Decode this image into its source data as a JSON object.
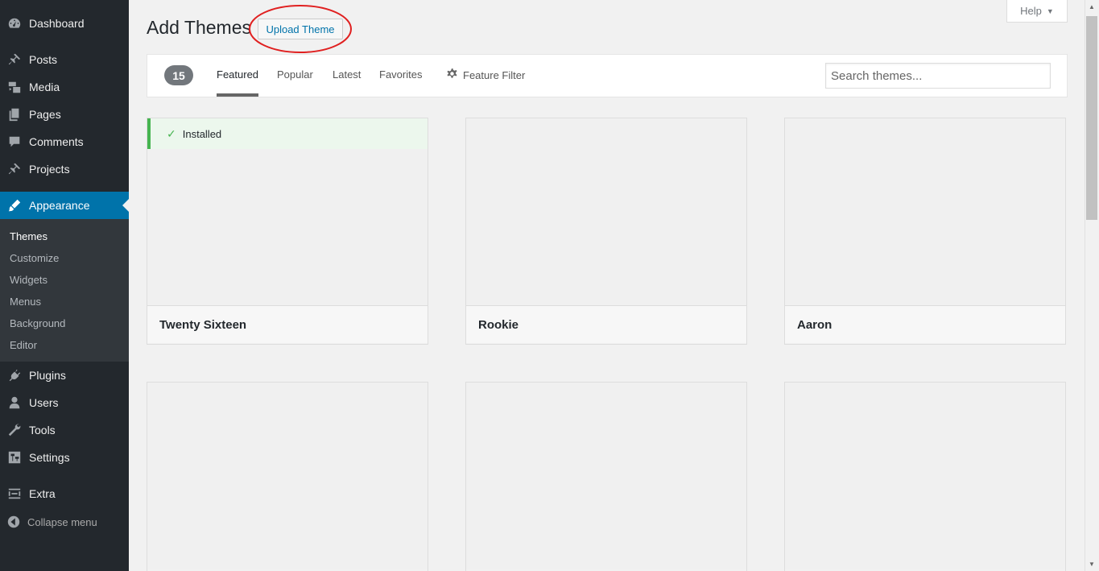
{
  "sidebar": {
    "items": [
      {
        "label": "Dashboard",
        "icon": "dashboard-icon"
      },
      {
        "label": "Posts",
        "icon": "pin-icon"
      },
      {
        "label": "Media",
        "icon": "media-icon"
      },
      {
        "label": "Pages",
        "icon": "pages-icon"
      },
      {
        "label": "Comments",
        "icon": "comment-icon"
      },
      {
        "label": "Projects",
        "icon": "pin-icon"
      },
      {
        "label": "Appearance",
        "icon": "brush-icon"
      },
      {
        "label": "Plugins",
        "icon": "plugin-icon"
      },
      {
        "label": "Users",
        "icon": "user-icon"
      },
      {
        "label": "Tools",
        "icon": "wrench-icon"
      },
      {
        "label": "Settings",
        "icon": "settings-icon"
      },
      {
        "label": "Extra",
        "icon": "extra-icon"
      }
    ],
    "submenu": [
      "Themes",
      "Customize",
      "Widgets",
      "Menus",
      "Background",
      "Editor"
    ],
    "collapse_label": "Collapse menu"
  },
  "header": {
    "title": "Add Themes",
    "upload_label": "Upload Theme",
    "help_label": "Help"
  },
  "filter_bar": {
    "count": "15",
    "tabs": [
      "Featured",
      "Popular",
      "Latest",
      "Favorites"
    ],
    "feature_filter": "Feature Filter",
    "search_placeholder": "Search themes..."
  },
  "themes": [
    {
      "name": "Twenty Sixteen",
      "installed": true,
      "installed_label": "Installed"
    },
    {
      "name": "Rookie",
      "installed": false
    },
    {
      "name": "Aaron",
      "installed": false
    },
    {
      "name": "",
      "installed": false
    },
    {
      "name": "",
      "installed": false
    },
    {
      "name": "",
      "installed": false
    }
  ],
  "colors": {
    "sidebar_bg": "#23282d",
    "active_bg": "#0073aa",
    "installed_green": "#46b450",
    "annotation_red": "#e02020"
  }
}
